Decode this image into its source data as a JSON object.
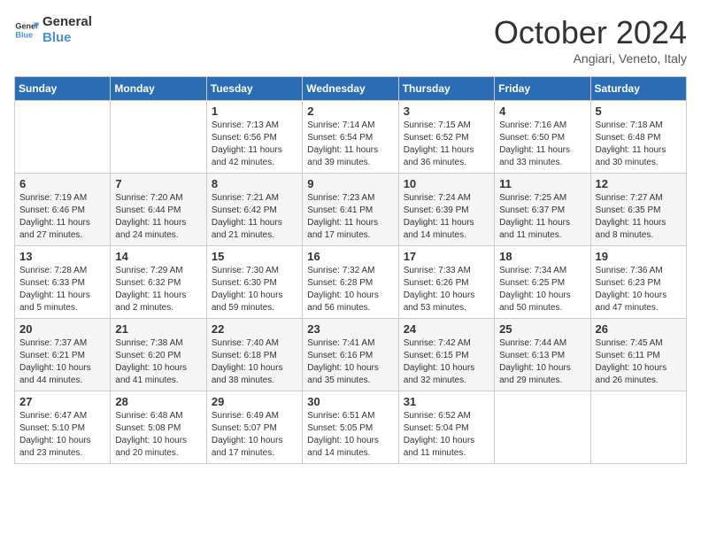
{
  "header": {
    "logo_line1": "General",
    "logo_line2": "Blue",
    "month_title": "October 2024",
    "subtitle": "Angiari, Veneto, Italy"
  },
  "days_of_week": [
    "Sunday",
    "Monday",
    "Tuesday",
    "Wednesday",
    "Thursday",
    "Friday",
    "Saturday"
  ],
  "weeks": [
    [
      {
        "day": "",
        "info": ""
      },
      {
        "day": "",
        "info": ""
      },
      {
        "day": "1",
        "info": "Sunrise: 7:13 AM\nSunset: 6:56 PM\nDaylight: 11 hours and 42 minutes."
      },
      {
        "day": "2",
        "info": "Sunrise: 7:14 AM\nSunset: 6:54 PM\nDaylight: 11 hours and 39 minutes."
      },
      {
        "day": "3",
        "info": "Sunrise: 7:15 AM\nSunset: 6:52 PM\nDaylight: 11 hours and 36 minutes."
      },
      {
        "day": "4",
        "info": "Sunrise: 7:16 AM\nSunset: 6:50 PM\nDaylight: 11 hours and 33 minutes."
      },
      {
        "day": "5",
        "info": "Sunrise: 7:18 AM\nSunset: 6:48 PM\nDaylight: 11 hours and 30 minutes."
      }
    ],
    [
      {
        "day": "6",
        "info": "Sunrise: 7:19 AM\nSunset: 6:46 PM\nDaylight: 11 hours and 27 minutes."
      },
      {
        "day": "7",
        "info": "Sunrise: 7:20 AM\nSunset: 6:44 PM\nDaylight: 11 hours and 24 minutes."
      },
      {
        "day": "8",
        "info": "Sunrise: 7:21 AM\nSunset: 6:42 PM\nDaylight: 11 hours and 21 minutes."
      },
      {
        "day": "9",
        "info": "Sunrise: 7:23 AM\nSunset: 6:41 PM\nDaylight: 11 hours and 17 minutes."
      },
      {
        "day": "10",
        "info": "Sunrise: 7:24 AM\nSunset: 6:39 PM\nDaylight: 11 hours and 14 minutes."
      },
      {
        "day": "11",
        "info": "Sunrise: 7:25 AM\nSunset: 6:37 PM\nDaylight: 11 hours and 11 minutes."
      },
      {
        "day": "12",
        "info": "Sunrise: 7:27 AM\nSunset: 6:35 PM\nDaylight: 11 hours and 8 minutes."
      }
    ],
    [
      {
        "day": "13",
        "info": "Sunrise: 7:28 AM\nSunset: 6:33 PM\nDaylight: 11 hours and 5 minutes."
      },
      {
        "day": "14",
        "info": "Sunrise: 7:29 AM\nSunset: 6:32 PM\nDaylight: 11 hours and 2 minutes."
      },
      {
        "day": "15",
        "info": "Sunrise: 7:30 AM\nSunset: 6:30 PM\nDaylight: 10 hours and 59 minutes."
      },
      {
        "day": "16",
        "info": "Sunrise: 7:32 AM\nSunset: 6:28 PM\nDaylight: 10 hours and 56 minutes."
      },
      {
        "day": "17",
        "info": "Sunrise: 7:33 AM\nSunset: 6:26 PM\nDaylight: 10 hours and 53 minutes."
      },
      {
        "day": "18",
        "info": "Sunrise: 7:34 AM\nSunset: 6:25 PM\nDaylight: 10 hours and 50 minutes."
      },
      {
        "day": "19",
        "info": "Sunrise: 7:36 AM\nSunset: 6:23 PM\nDaylight: 10 hours and 47 minutes."
      }
    ],
    [
      {
        "day": "20",
        "info": "Sunrise: 7:37 AM\nSunset: 6:21 PM\nDaylight: 10 hours and 44 minutes."
      },
      {
        "day": "21",
        "info": "Sunrise: 7:38 AM\nSunset: 6:20 PM\nDaylight: 10 hours and 41 minutes."
      },
      {
        "day": "22",
        "info": "Sunrise: 7:40 AM\nSunset: 6:18 PM\nDaylight: 10 hours and 38 minutes."
      },
      {
        "day": "23",
        "info": "Sunrise: 7:41 AM\nSunset: 6:16 PM\nDaylight: 10 hours and 35 minutes."
      },
      {
        "day": "24",
        "info": "Sunrise: 7:42 AM\nSunset: 6:15 PM\nDaylight: 10 hours and 32 minutes."
      },
      {
        "day": "25",
        "info": "Sunrise: 7:44 AM\nSunset: 6:13 PM\nDaylight: 10 hours and 29 minutes."
      },
      {
        "day": "26",
        "info": "Sunrise: 7:45 AM\nSunset: 6:11 PM\nDaylight: 10 hours and 26 minutes."
      }
    ],
    [
      {
        "day": "27",
        "info": "Sunrise: 6:47 AM\nSunset: 5:10 PM\nDaylight: 10 hours and 23 minutes."
      },
      {
        "day": "28",
        "info": "Sunrise: 6:48 AM\nSunset: 5:08 PM\nDaylight: 10 hours and 20 minutes."
      },
      {
        "day": "29",
        "info": "Sunrise: 6:49 AM\nSunset: 5:07 PM\nDaylight: 10 hours and 17 minutes."
      },
      {
        "day": "30",
        "info": "Sunrise: 6:51 AM\nSunset: 5:05 PM\nDaylight: 10 hours and 14 minutes."
      },
      {
        "day": "31",
        "info": "Sunrise: 6:52 AM\nSunset: 5:04 PM\nDaylight: 10 hours and 11 minutes."
      },
      {
        "day": "",
        "info": ""
      },
      {
        "day": "",
        "info": ""
      }
    ]
  ]
}
